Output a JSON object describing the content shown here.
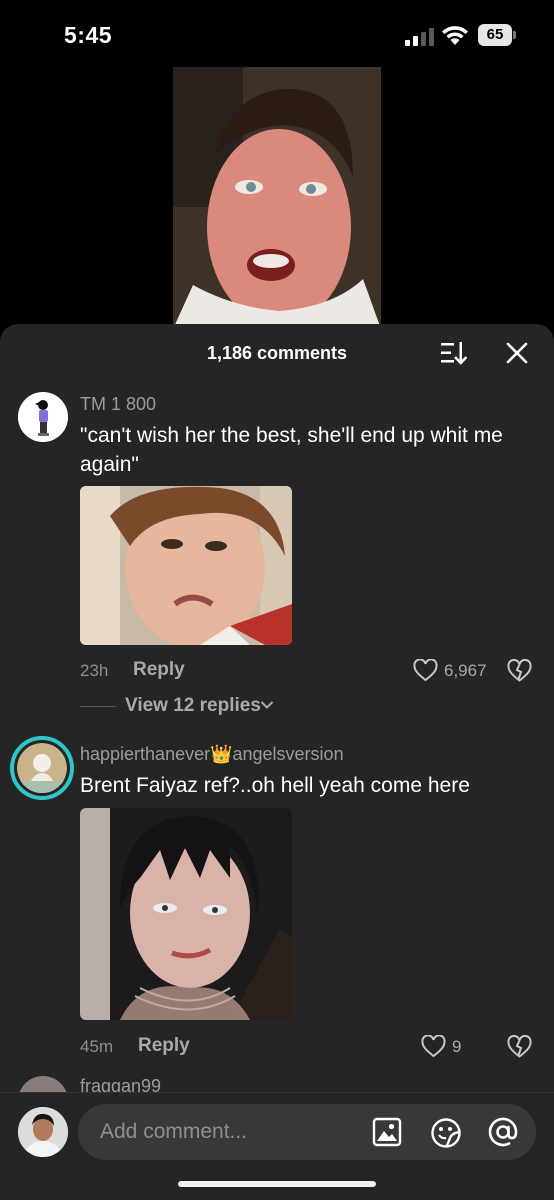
{
  "status_bar": {
    "time": "5:45",
    "battery_level": "65"
  },
  "comments_panel": {
    "count_label": "1,186 comments",
    "icons": {
      "sort": "sort-icon",
      "close": "close-icon"
    }
  },
  "comments": [
    {
      "username": "TM 1 800",
      "text": "\"can't wish her the best, she'll end up whit me again\"",
      "timestamp": "23h",
      "reply_label": "Reply",
      "likes": "6,967",
      "view_replies_label": "View 12 replies"
    },
    {
      "username": "happierthanever👑angelsversion",
      "text": "Brent Faiyaz ref?..oh hell yeah come here",
      "timestamp": "45m",
      "reply_label": "Reply",
      "likes": "9"
    },
    {
      "username": "fraggan99"
    }
  ],
  "composer": {
    "placeholder": "Add comment...",
    "icons": [
      "image-icon",
      "emoji-icon",
      "mention-icon"
    ]
  },
  "colors": {
    "sheet_background": "#252525",
    "input_background": "#383838",
    "secondary_text": "#a9a9a9",
    "story_ring": "#2ec5c8"
  }
}
